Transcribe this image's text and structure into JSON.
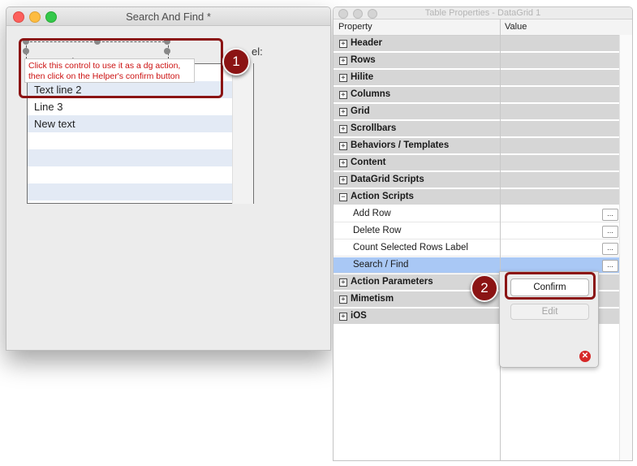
{
  "left_window": {
    "title": "Search And Find *",
    "label_fragment": "el:",
    "grid_rows": [
      "Text line 2",
      "Line 3",
      "New text",
      "",
      "",
      "",
      ""
    ],
    "tooltip": {
      "line1": "Click this control to use it as a dg action,",
      "line2": "then click on the Helper's confirm button"
    }
  },
  "annotations": {
    "badge_1": "1",
    "badge_2": "2",
    "color": "#8b1414"
  },
  "right_window": {
    "title": "Table Properties - DataGrid 1",
    "columns": {
      "property": "Property",
      "value": "Value"
    },
    "groups_top": [
      {
        "label": "Header",
        "expander": "+"
      },
      {
        "label": "Rows",
        "expander": "+"
      },
      {
        "label": "Hilite",
        "expander": "+"
      },
      {
        "label": "Columns",
        "expander": "+"
      },
      {
        "label": "Grid",
        "expander": "+"
      },
      {
        "label": "Scrollbars",
        "expander": "+"
      },
      {
        "label": "Behaviors / Templates",
        "expander": "+"
      },
      {
        "label": "Content",
        "expander": "+"
      },
      {
        "label": "DataGrid Scripts",
        "expander": "+"
      },
      {
        "label": "Action Scripts",
        "expander": "−"
      }
    ],
    "action_scripts": [
      {
        "label": "Add Row",
        "button": "..."
      },
      {
        "label": "Delete Row",
        "button": "..."
      },
      {
        "label": "Count Selected Rows Label",
        "button": "..."
      },
      {
        "label": "Search / Find",
        "button": "..."
      }
    ],
    "groups_bottom": [
      {
        "label": "Action Parameters",
        "expander": "+"
      },
      {
        "label": "Mimetism",
        "expander": "+"
      },
      {
        "label": "iOS",
        "expander": "+"
      }
    ],
    "selected_row": "Search / Find",
    "selected_color": "#a9c8f5"
  },
  "popup": {
    "confirm": "Confirm",
    "edit": "Edit",
    "close_icon": "close-icon"
  }
}
